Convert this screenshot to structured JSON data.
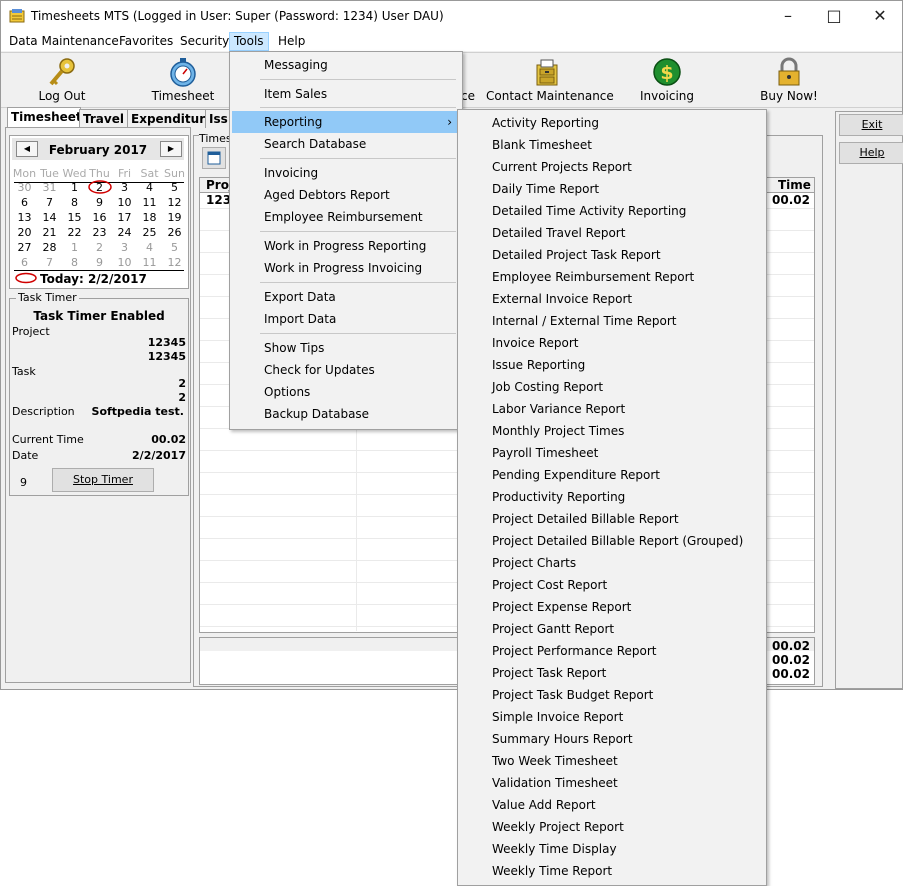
{
  "window": {
    "title": "Timesheets MTS (Logged in User: Super (Password: 1234) User DAU)",
    "minimize": "–",
    "maximize": "□",
    "close": "✕"
  },
  "menubar": [
    "Data Maintenance",
    "Favorites",
    "Security",
    "Tools",
    "Help"
  ],
  "toolbar": {
    "log_out": "Log Out",
    "timesheet": "Timesheet",
    "contact_maintenance": "Contact Maintenance",
    "invoicing": "Invoicing",
    "buy_now": "Buy Now!",
    "partial_label": "ce"
  },
  "tabs": [
    "Timesheet",
    "Travel",
    "Expenditure",
    "Iss"
  ],
  "calendar": {
    "month": "February 2017",
    "weekdays": [
      "Mon",
      "Tue",
      "Wed",
      "Thu",
      "Fri",
      "Sat",
      "Sun"
    ],
    "weeks": [
      [
        "30",
        "31",
        "1",
        "2",
        "3",
        "4",
        "5"
      ],
      [
        "6",
        "7",
        "8",
        "9",
        "10",
        "11",
        "12"
      ],
      [
        "13",
        "14",
        "15",
        "16",
        "17",
        "18",
        "19"
      ],
      [
        "20",
        "21",
        "22",
        "23",
        "24",
        "25",
        "26"
      ],
      [
        "27",
        "28",
        "1",
        "2",
        "3",
        "4",
        "5"
      ],
      [
        "6",
        "7",
        "8",
        "9",
        "10",
        "11",
        "12"
      ]
    ],
    "today": "Today: 2/2/2017"
  },
  "task_timer": {
    "caption": "Task Timer",
    "status": "Task Timer Enabled",
    "project_label": "Project",
    "project_1": "12345",
    "project_2": "12345",
    "task_label": "Task",
    "task_1": "2",
    "task_2": "2",
    "description_label": "Description",
    "description": "Softpedia test.",
    "current_time_label": "Current Time",
    "current_time": "00.02",
    "date_label": "Date",
    "date": "2/2/2017",
    "counter": "9",
    "stop_button": "Stop Timer"
  },
  "main": {
    "timesheet_caption": "Timesh",
    "col_project": "Proj",
    "row_project": "1234",
    "col_time": "Time",
    "row_time": "00.02",
    "summary": [
      "00.02",
      "00.02",
      "00.02"
    ]
  },
  "side_buttons": {
    "exit": "Exit",
    "help": "Help"
  },
  "tools_menu": {
    "items": [
      "Messaging",
      "Item Sales",
      "Reporting",
      "Search Database",
      "Invoicing",
      "Aged Debtors Report",
      "Employee Reimbursement",
      "Work in Progress Reporting",
      "Work in Progress Invoicing",
      "Export Data",
      "Import Data",
      "Show Tips",
      "Check for Updates",
      "Options",
      "Backup Database"
    ]
  },
  "reporting_menu": {
    "items": [
      "Activity Reporting",
      "Blank Timesheet",
      "Current Projects Report",
      "Daily Time Report",
      "Detailed Time Activity Reporting",
      "Detailed Travel Report",
      "Detailed Project Task Report",
      "Employee Reimbursement Report",
      "External Invoice Report",
      "Internal / External Time Report",
      "Invoice Report",
      "Issue Reporting",
      "Job Costing Report",
      "Labor Variance Report",
      "Monthly Project Times",
      "Payroll Timesheet",
      "Pending Expenditure Report",
      "Productivity Reporting",
      "Project Detailed Billable Report",
      "Project Detailed Billable Report (Grouped)",
      "Project Charts",
      "Project Cost Report",
      "Project Expense Report",
      "Project Gantt Report",
      "Project Performance Report",
      "Project Task Report",
      "Project Task Budget Report",
      "Simple Invoice Report",
      "Summary Hours Report",
      "Two Week Timesheet",
      "Validation Timesheet",
      "Value Add Report",
      "Weekly Project Report",
      "Weekly Time Display",
      "Weekly Time Report"
    ]
  },
  "colors": {
    "menu_highlight": "#91c9f7",
    "active_menu": "#cce8ff",
    "today_circle": "#d00000"
  }
}
